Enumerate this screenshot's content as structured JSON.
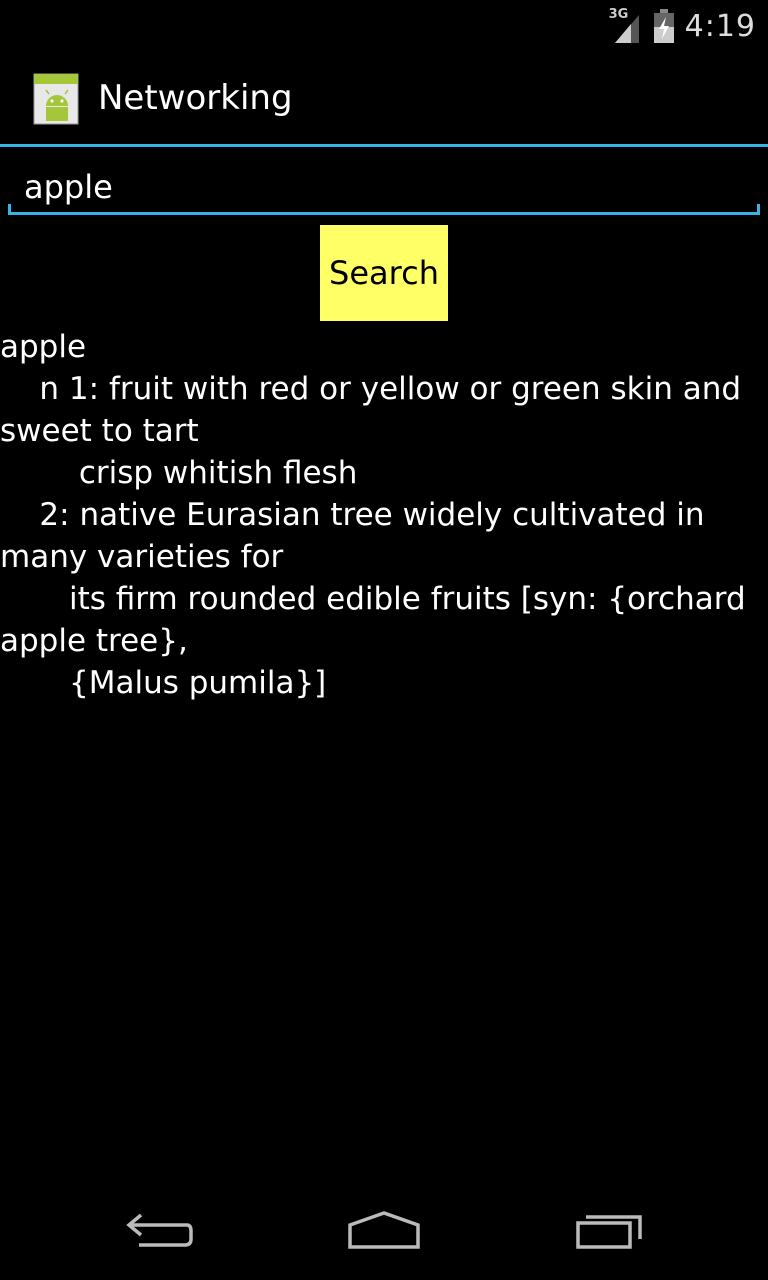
{
  "status_bar": {
    "network": "3G",
    "time": "4:19",
    "icons": [
      "signal-icon",
      "battery-icon"
    ]
  },
  "action_bar": {
    "title": "Networking",
    "icon": "android-app-icon"
  },
  "search": {
    "value": "apple",
    "button_label": "Search",
    "button_color": "#ffff66"
  },
  "result": {
    "text": "apple\n    n 1: fruit with red or yellow or green skin and sweet to tart\n        crisp whitish flesh\n    2: native Eurasian tree widely cultivated in many varieties for\n       its firm rounded edible fruits [syn: {orchard apple tree},\n       {Malus pumila}]"
  },
  "nav_bar": {
    "icons": [
      "back-icon",
      "home-icon",
      "recents-icon"
    ]
  },
  "colors": {
    "accent": "#33b5e5",
    "background": "#000000"
  }
}
